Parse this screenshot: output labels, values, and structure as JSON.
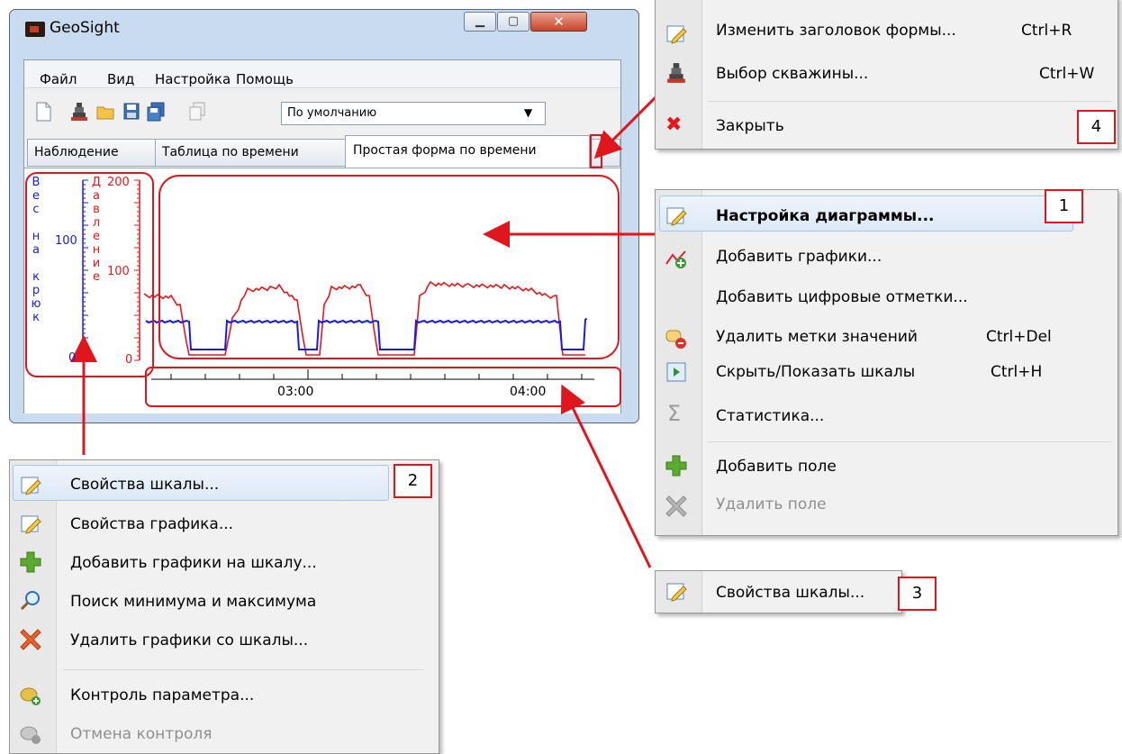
{
  "window": {
    "title": "GeoSight",
    "menu": [
      "Файл",
      "Вид",
      "Настройка",
      "Помощь"
    ],
    "combo_value": "По умолчанию",
    "tabs": [
      "Наблюдение",
      "Таблица по времени",
      "Простая форма по времени"
    ]
  },
  "chart": {
    "left_scale_label": "Вес на крюк",
    "left_scale_ticks": [
      "100",
      "0"
    ],
    "right_scale_label": "Давление",
    "right_scale_ticks": [
      "200",
      "100",
      "0"
    ],
    "time_ticks": [
      "03:00",
      "04:00"
    ],
    "colors": {
      "weight": "#1a1ae6",
      "pressure": "#e8161b",
      "highlight": "#e0161d"
    }
  },
  "menu1": {
    "badge": "1",
    "items": [
      "Настройка диаграммы...",
      "Добавить графики...",
      "Добавить цифровые отметки...",
      "Удалить метки значений",
      "Скрыть/Показать шкалы",
      "Статистика...",
      "Добавить поле",
      "Удалить поле"
    ],
    "shortcuts": {
      "delete_marks": "Ctrl+Del",
      "toggle_scales": "Ctrl+H"
    }
  },
  "menu2": {
    "badge": "2",
    "items": [
      "Свойства шкалы...",
      "Свойства графика...",
      "Добавить графики на шкалу...",
      "Поиск минимума и максимума",
      "Удалить графики со шкалы...",
      "Контроль параметра...",
      "Отмена контроля"
    ]
  },
  "menu3": {
    "badge": "3",
    "item": "Свойства шкалы..."
  },
  "menu4": {
    "badge": "4",
    "items": [
      "Изменить заголовок формы...",
      "Выбор скважины...",
      "Закрыть"
    ],
    "shortcuts": {
      "rename": "Ctrl+R",
      "well": "Ctrl+W"
    }
  }
}
